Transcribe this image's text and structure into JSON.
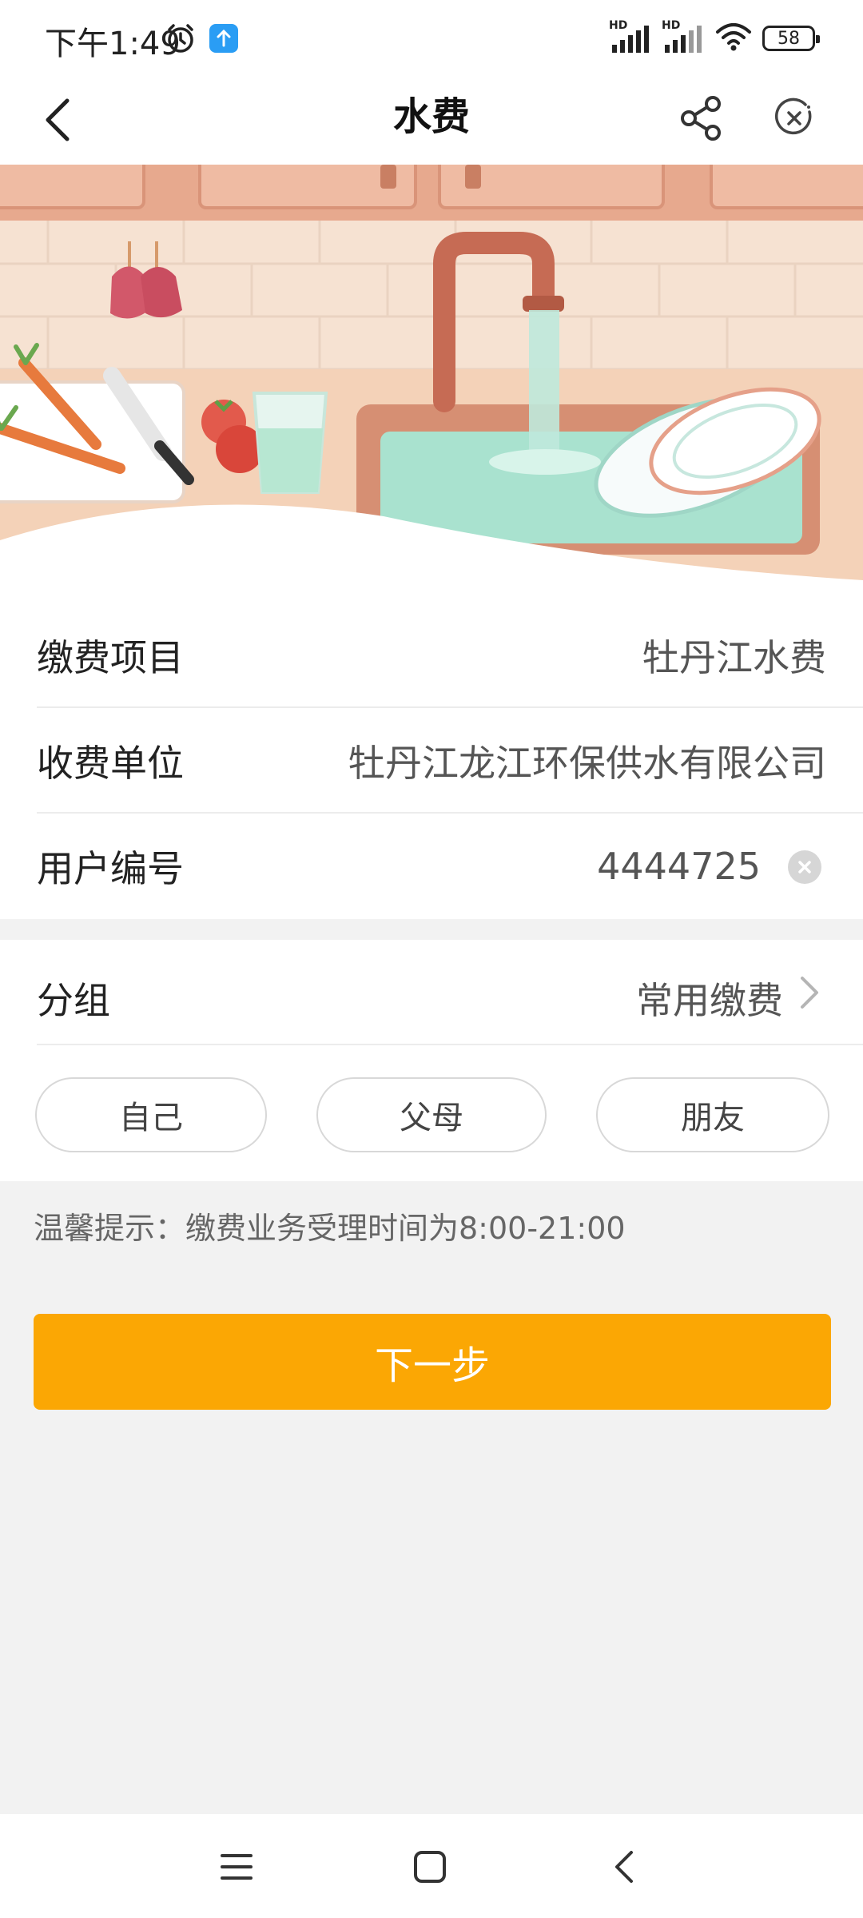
{
  "status_bar": {
    "time": "下午1:49",
    "network_1": "HD",
    "network_2": "HD",
    "battery": "58",
    "icons": [
      "alarm-icon",
      "app-notification-icon",
      "signal-icon",
      "wifi-icon",
      "battery-icon"
    ]
  },
  "header": {
    "title": "水费",
    "icons": [
      "back-arrow-icon",
      "share-icon",
      "close-circle-icon"
    ]
  },
  "form": {
    "item_label": "缴费项目",
    "item_value": "牡丹江水费",
    "unit_label": "收费单位",
    "unit_value": "牡丹江龙江环保供水有限公司",
    "userid_label": "用户编号",
    "userid_value": "4444725"
  },
  "group": {
    "label": "分组",
    "value": "常用缴费",
    "chips": [
      "自己",
      "父母",
      "朋友"
    ]
  },
  "tip": "温馨提示：缴费业务受理时间为8:00-21:00",
  "next_button": "下一步",
  "colors": {
    "accent": "#fba704",
    "background": "#f2f2f2",
    "card": "#ffffff"
  }
}
